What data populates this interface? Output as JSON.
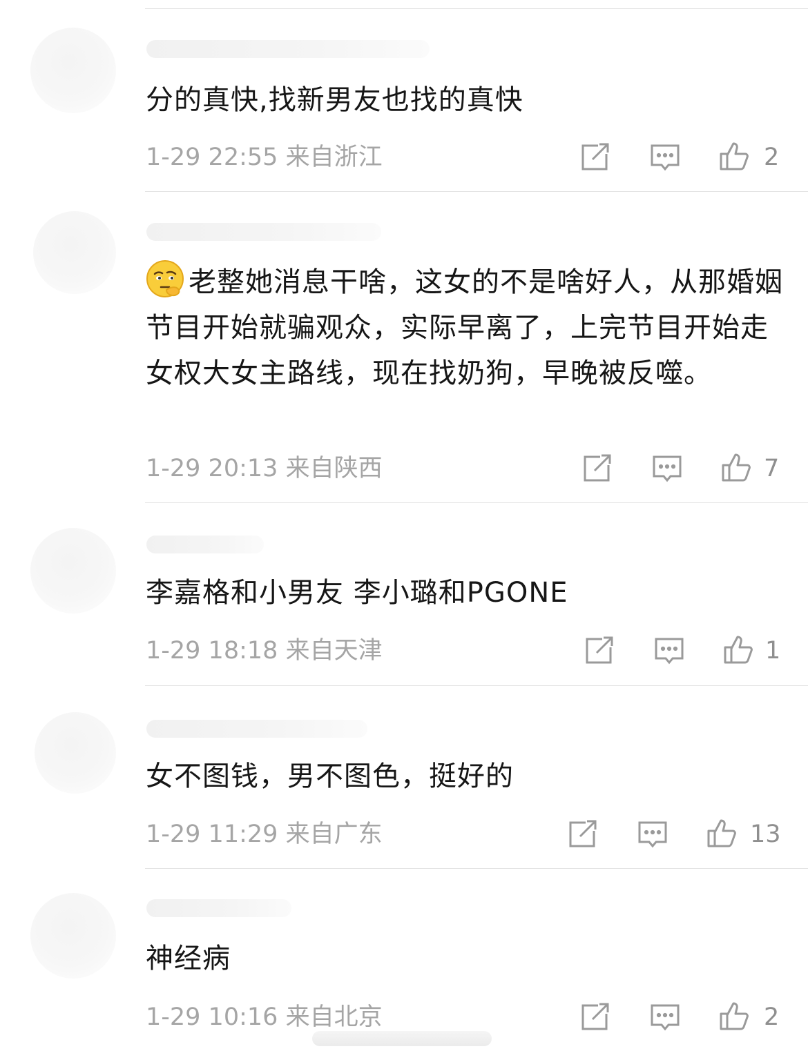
{
  "colors": {
    "text": "#161616",
    "meta": "#a5a5a5",
    "icon": "#9a9a9a",
    "divider": "#e4e4e4"
  },
  "comments": [
    {
      "text": "分的真快,找新男友也找的真快",
      "time": "1-29 22:55",
      "location": "来自浙江",
      "likes": "2",
      "has_emoji": false
    },
    {
      "text": "老整她消息干啥，这女的不是啥好人，从那婚姻节目开始就骗观众，实际早离了，上完节目开始走女权大女主路线，现在找奶狗，早晚被反噬。",
      "time": "1-29 20:13",
      "location": "来自陕西",
      "likes": "7",
      "has_emoji": true,
      "emoji": "thinking-face-emoji"
    },
    {
      "text": "李嘉格和小男友  李小璐和PGONE",
      "time": "1-29 18:18",
      "location": "来自天津",
      "likes": "1",
      "has_emoji": false
    },
    {
      "text": "女不图钱，男不图色，挺好的",
      "time": "1-29 11:29",
      "location": "来自广东",
      "likes": "13",
      "has_emoji": false
    },
    {
      "text": "神经病",
      "time": "1-29 10:16",
      "location": "来自北京",
      "likes": "2",
      "has_emoji": false
    }
  ],
  "icons": {
    "share": "share-icon",
    "reply": "comment-icon",
    "like": "thumbs-up-icon"
  }
}
